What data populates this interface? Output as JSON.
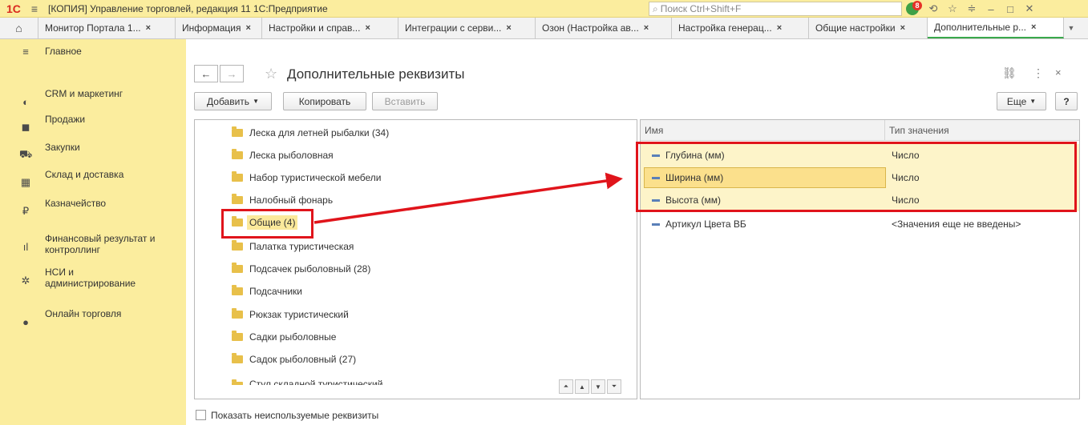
{
  "titlebar": {
    "app_title": "[КОПИЯ] Управление торговлей, редакция 11 1С:Предприятие",
    "search_placeholder": "Поиск Ctrl+Shift+F",
    "notifications_count": "8"
  },
  "tabs": [
    {
      "label": "Монитор Портала 1..."
    },
    {
      "label": "Информация"
    },
    {
      "label": "Настройки и справ..."
    },
    {
      "label": "Интеграции с серви..."
    },
    {
      "label": "Озон (Настройка ав..."
    },
    {
      "label": "Настройка генерац..."
    },
    {
      "label": "Общие настройки"
    },
    {
      "label": "Дополнительные р..."
    }
  ],
  "sidebar": {
    "items": [
      {
        "label": "Главное",
        "icon": "menu-icon"
      },
      {
        "label": "CRM и маркетинг",
        "icon": "crm-icon"
      },
      {
        "label": "Продажи",
        "icon": "sales-icon"
      },
      {
        "label": "Закупки",
        "icon": "cart-icon"
      },
      {
        "label": "Склад и доставка",
        "icon": "warehouse-icon"
      },
      {
        "label": "Казначейство",
        "icon": "ruble-icon"
      },
      {
        "label": "Финансовый результат и контроллинг",
        "icon": "chart-icon"
      },
      {
        "label": "НСИ и администрирование",
        "icon": "gear-icon"
      },
      {
        "label": "Онлайн торговля",
        "icon": "globe-icon"
      }
    ]
  },
  "page": {
    "title": "Дополнительные реквизиты"
  },
  "toolbar": {
    "add_label": "Добавить",
    "copy_label": "Копировать",
    "paste_label": "Вставить",
    "more_label": "Еще",
    "help_label": "?"
  },
  "tree": {
    "items": [
      {
        "label": "Леска для летней рыбалки (34)"
      },
      {
        "label": "Леска рыболовная"
      },
      {
        "label": "Набор туристической мебели"
      },
      {
        "label": "Налобный фонарь"
      },
      {
        "label": "Общие (4)"
      },
      {
        "label": "Палатка туристическая"
      },
      {
        "label": "Подсачек рыболовный (28)"
      },
      {
        "label": "Подсачники"
      },
      {
        "label": "Рюкзак туристический"
      },
      {
        "label": "Садки рыболовные"
      },
      {
        "label": "Садок рыболовный (27)"
      },
      {
        "label": "Стул складной туристический"
      }
    ],
    "selected_index": 4
  },
  "table": {
    "columns": [
      "Имя",
      "Тип значения"
    ],
    "rows": [
      {
        "name": "Глубина (мм)",
        "type": "Число"
      },
      {
        "name": "Ширина (мм)",
        "type": "Число"
      },
      {
        "name": "Высота (мм)",
        "type": "Число"
      },
      {
        "name": "Артикул Цвета ВБ",
        "type": "<Значения еще не введены>"
      }
    ]
  },
  "footer": {
    "show_unused_label": "Показать неиспользуемые реквизиты"
  },
  "colors": {
    "sidebar_bg": "#fbed9e",
    "accent_green": "#3aa94c",
    "annotation_red": "#e0141b",
    "selection_yellow": "#fbe08c"
  }
}
